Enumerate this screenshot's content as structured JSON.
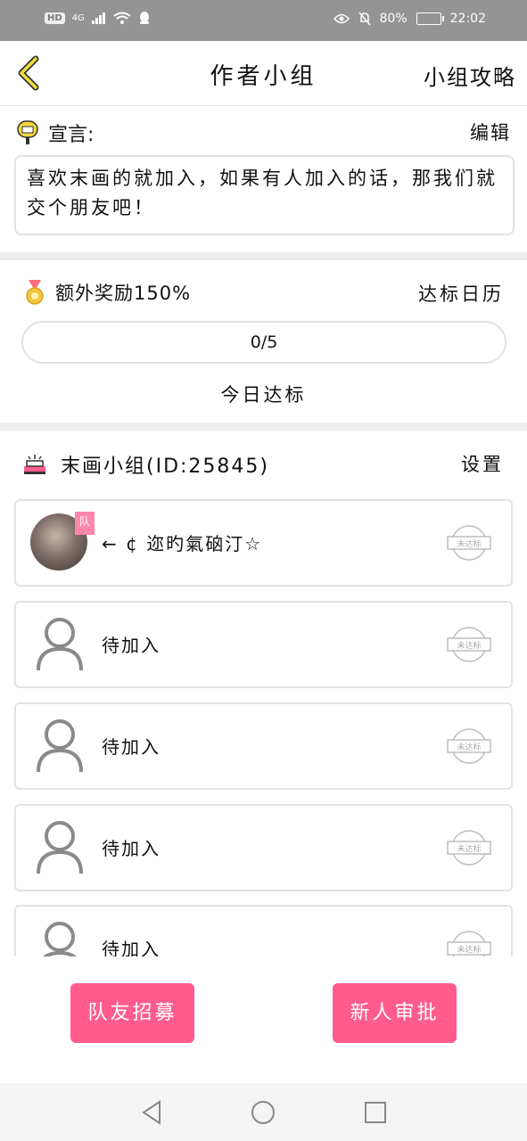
{
  "status_bar": {
    "hd": "HD",
    "network": "4G",
    "battery": "80%",
    "time": "22:02"
  },
  "header": {
    "title": "作者小组",
    "guide_link": "小组攻略"
  },
  "declaration": {
    "label": "宣言:",
    "edit": "编辑",
    "text": "喜欢末画的就加入，如果有人加入的话，那我们就交个朋友吧！"
  },
  "reward": {
    "label": "额外奖励150%",
    "calendar": "达标日历",
    "progress": "0/5",
    "progress_fraction": 0,
    "today": "今日达标"
  },
  "group": {
    "name": "末画小组(ID:25845)",
    "settings": "设置"
  },
  "members": [
    {
      "name": "← ¢ 迩旳氣硇汀☆",
      "badge": "队",
      "stamp": "未达标"
    },
    {
      "name": "待加入",
      "stamp": "未达标"
    },
    {
      "name": "待加入",
      "stamp": "未达标"
    },
    {
      "name": "待加入",
      "stamp": "未达标"
    },
    {
      "name": "待加入",
      "stamp": "未达标"
    }
  ],
  "actions": {
    "recruit": "队友招募",
    "approve": "新人审批"
  },
  "colors": {
    "accent_pink": "#ff5c8d",
    "back_arrow_yellow": "#f2dd3c"
  },
  "icons": [
    "back-arrow-icon",
    "mailbox-icon",
    "medal-icon",
    "group-icon",
    "person-icon",
    "stamp-icon",
    "nav-back-icon",
    "nav-home-icon",
    "nav-recent-icon"
  ]
}
